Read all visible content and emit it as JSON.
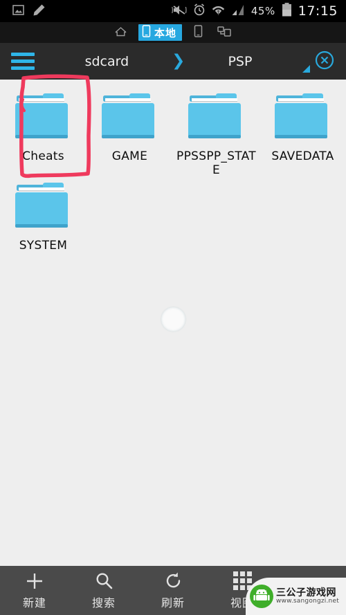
{
  "status_bar": {
    "left_icons": [
      {
        "name": "photo-icon",
        "glyph": "photo"
      },
      {
        "name": "edit-pencil-icon",
        "glyph": "pencil"
      }
    ],
    "right_icons": [
      {
        "name": "silent-vibrate-icon",
        "glyph": "muted-speaker"
      },
      {
        "name": "alarm-clock-icon",
        "glyph": "alarm"
      },
      {
        "name": "wifi-icon",
        "glyph": "wifi"
      },
      {
        "name": "cellular-signal-icon",
        "glyph": "signal-bars"
      }
    ],
    "battery_percent": "45%",
    "battery_icon": "battery-icon",
    "clock": "17:15"
  },
  "tab_strip": {
    "tabs": [
      {
        "id": "home",
        "icon": "home-icon",
        "label": "",
        "active": false
      },
      {
        "id": "local",
        "icon": "phone-icon",
        "label": "本地",
        "active": true
      },
      {
        "id": "device",
        "icon": "tablet-icon",
        "label": "",
        "active": false
      },
      {
        "id": "network",
        "icon": "network-share-icon",
        "label": "",
        "active": false
      }
    ]
  },
  "path_bar": {
    "menu_icon": "hamburger-menu-icon",
    "crumbs": [
      "sdcard",
      "PSP"
    ],
    "separator": "❯",
    "resize_handle_icon": "resize-corner-icon",
    "close_icon": "close-circle-icon"
  },
  "file_grid": {
    "items": [
      {
        "name": "Cheats",
        "type": "folder",
        "highlighted": true
      },
      {
        "name": "GAME",
        "type": "folder",
        "highlighted": false
      },
      {
        "name": "PPSSPP_STATE",
        "type": "folder",
        "highlighted": false
      },
      {
        "name": "SAVEDATA",
        "type": "folder",
        "highlighted": false
      },
      {
        "name": "SYSTEM",
        "type": "folder",
        "highlighted": false
      }
    ],
    "loading_indicator": "touch-ripple"
  },
  "annotation": {
    "shape": "hand-drawn-rectangle",
    "color": "#ef3a5d",
    "target": "Cheats"
  },
  "toolbar": {
    "items": [
      {
        "id": "new",
        "label": "新建",
        "icon": "plus-icon"
      },
      {
        "id": "search",
        "label": "搜索",
        "icon": "search-icon"
      },
      {
        "id": "refresh",
        "label": "刷新",
        "icon": "refresh-icon"
      },
      {
        "id": "view",
        "label": "视图",
        "icon": "grid-view-icon"
      },
      {
        "id": "more",
        "label": "",
        "icon": "multi-window-icon"
      }
    ]
  },
  "watermark": {
    "site_name": "三公子游戏网",
    "site_url": "www.sangongzi.net",
    "logo_icon": "android-robot-icon"
  },
  "colors": {
    "accent_blue": "#29a9dd",
    "folder_blue": "#5bc5ea",
    "status_bar_bg": "#000000",
    "tab_bg": "#161616",
    "path_bar_bg": "#2b2b2b",
    "content_bg": "#eeeeee",
    "toolbar_bg": "#4a4a4a",
    "annotation_red": "#ef3a5d"
  }
}
